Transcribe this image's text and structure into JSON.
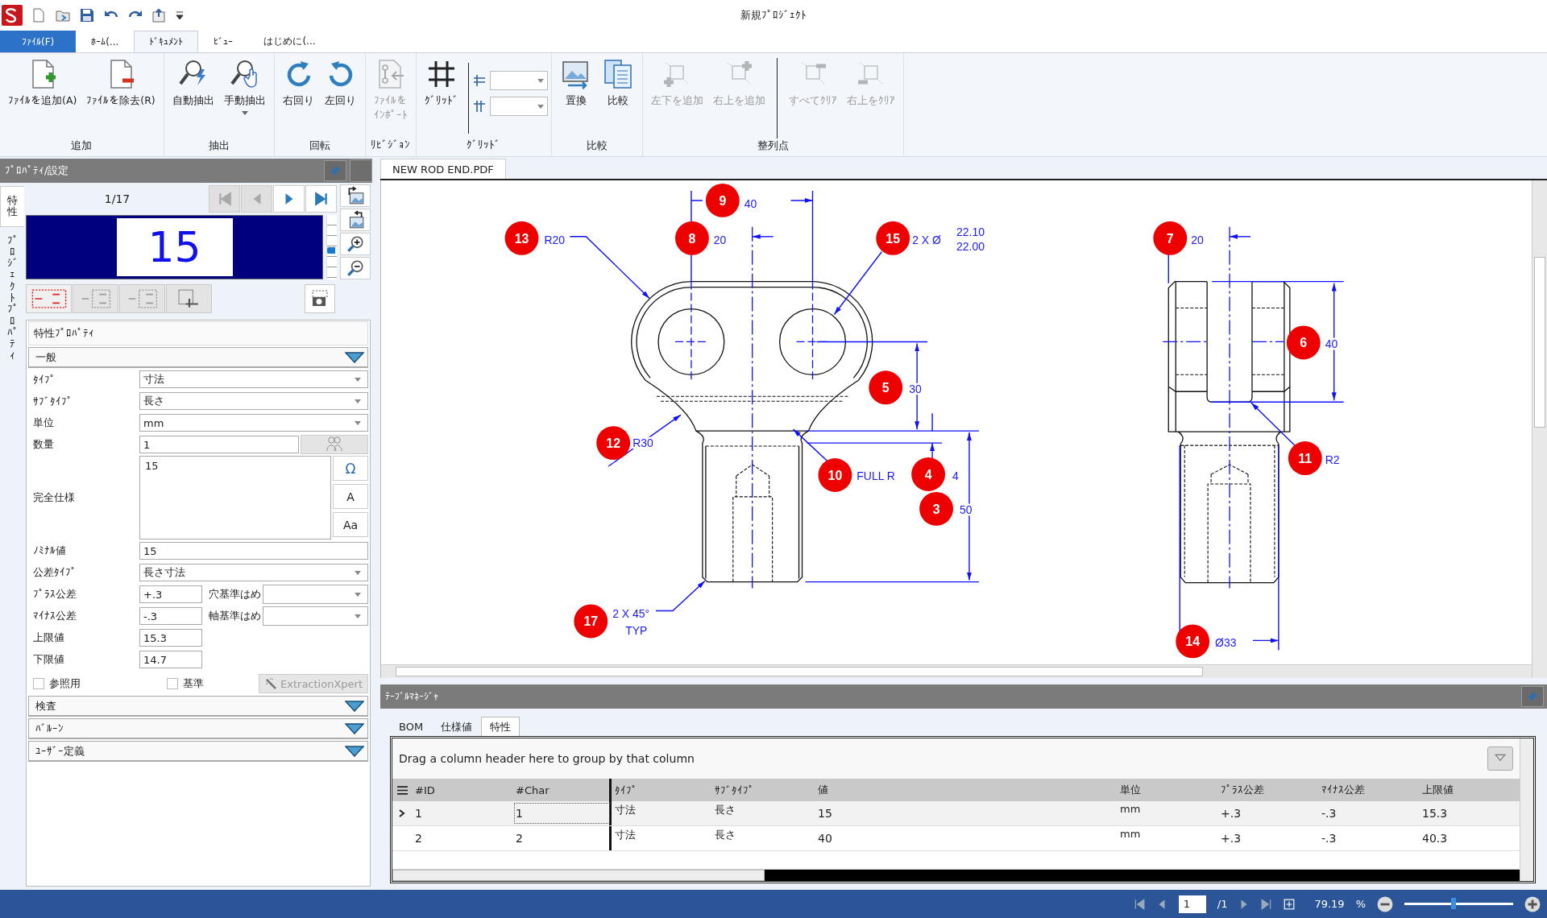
{
  "window": {
    "title": "新規ﾌﾟﾛｼﾞｪｸﾄ"
  },
  "ribbon_tabs": [
    {
      "label": "ﾌｧｲﾙ(F)",
      "kind": "file",
      "selected": false
    },
    {
      "label": "ﾎｰﾑ(...",
      "kind": "tab",
      "selected": false
    },
    {
      "label": "ﾄﾞｷｭﾒﾝﾄ",
      "kind": "tab",
      "selected": true
    },
    {
      "label": "ﾋﾞｭｰ",
      "kind": "tab",
      "selected": false
    },
    {
      "label": "はじめに(...",
      "kind": "tab",
      "selected": false
    }
  ],
  "ribbon": {
    "groups": [
      {
        "label": "追加",
        "kind": "buttons",
        "buttons": [
          {
            "label": "ﾌｧｲﾙを追加(A)",
            "disabled": false
          },
          {
            "label": "ﾌｧｲﾙを除去(R)",
            "disabled": false
          }
        ]
      },
      {
        "label": "抽出",
        "kind": "buttons",
        "buttons": [
          {
            "label": "自動抽出",
            "disabled": false
          },
          {
            "label": "手動抽出",
            "disabled": false,
            "dropdown": true
          }
        ]
      },
      {
        "label": "回転",
        "kind": "buttons",
        "buttons": [
          {
            "label": "右回り",
            "disabled": false
          },
          {
            "label": "左回り",
            "disabled": false
          }
        ]
      },
      {
        "label": "ﾘﾋﾞｼﾞｮﾝ",
        "kind": "buttons",
        "buttons": [
          {
            "label": "ﾌｧｲﾙを",
            "label_line2": "ｲﾝﾎﾟｰﾄ",
            "disabled": true
          }
        ]
      },
      {
        "label": "ｸﾞﾘｯﾄﾞ",
        "kind": "grid",
        "buttons": [
          {
            "label": "ｸﾞﾘｯﾄﾞ",
            "disabled": false
          }
        ]
      },
      {
        "label": "比較",
        "kind": "buttons",
        "buttons": [
          {
            "label": "置換",
            "disabled": false
          },
          {
            "label": "比較",
            "disabled": false
          }
        ]
      },
      {
        "label": "整列点",
        "kind": "buttons",
        "buttons": [
          {
            "label": "左下を追加",
            "disabled": true
          },
          {
            "label": "右上を追加",
            "disabled": true
          },
          {
            "label": "すべてｸﾘｱ",
            "disabled": true,
            "divider_before": true
          },
          {
            "label": "右上をｸﾘｱ",
            "disabled": true
          }
        ]
      }
    ]
  },
  "properties_panel": {
    "title": "ﾌﾟﾛﾊﾟﾃｨ/設定",
    "side_tabs": [
      {
        "label": "特性",
        "selected": true
      },
      {
        "label": "ﾌﾟﾛｼﾞｪｸﾄﾌﾟﾛﾊﾟﾃｨ",
        "selected": false
      }
    ],
    "counter": "1/17",
    "nav_buttons": [
      {
        "disabled": true
      },
      {
        "disabled": true
      },
      {
        "disabled": false
      },
      {
        "disabled": false
      }
    ],
    "preview": "15",
    "preview_zoom": {
      "level": 0.45
    },
    "format_buttons": [
      {
        "selected": true
      },
      {
        "selected": false
      },
      {
        "selected": false
      },
      {
        "selected": false
      }
    ],
    "section_title": "特性ﾌﾟﾛﾊﾟﾃｨ",
    "general": {
      "label": "一般",
      "fields": [
        {
          "kind": "dropdown",
          "label": "ﾀｲﾌﾟ",
          "value": "寸法"
        },
        {
          "kind": "dropdown",
          "label": "ｻﾌﾞﾀｲﾌﾟ",
          "value": "長さ"
        },
        {
          "kind": "dropdown",
          "label": "単位",
          "value": "mm"
        },
        {
          "kind": "count",
          "label": "数量",
          "value": "1"
        },
        {
          "kind": "spec",
          "label": "完全仕様",
          "value": "15",
          "tools": [
            "Ω",
            "A",
            "Aa"
          ]
        },
        {
          "kind": "text",
          "label": "ﾉﾐﾅﾙ値",
          "value": "15"
        },
        {
          "kind": "dropdown",
          "label": "公差ﾀｲﾌﾟ",
          "value": "長さ寸法"
        },
        {
          "kind": "tolerance",
          "label": "ﾌﾟﾗｽ公差",
          "value": "+.3",
          "fit_label": "穴基準はめ"
        },
        {
          "kind": "tolerance",
          "label": "ﾏｲﾅｽ公差",
          "value": "-.3",
          "fit_label": "軸基準はめ"
        },
        {
          "kind": "short",
          "label": "上限値",
          "value": "15.3"
        },
        {
          "kind": "short",
          "label": "下限値",
          "value": "14.7"
        }
      ],
      "checkboxes": [
        {
          "label": "参照用",
          "checked": false
        },
        {
          "label": "基準",
          "checked": false
        }
      ],
      "xpert_button": {
        "label": "ExtractionXpert",
        "disabled": true
      }
    },
    "sections": [
      {
        "label": "検査"
      },
      {
        "label": "ﾊﾞﾙｰﾝ"
      },
      {
        "label": "ﾕｰｻﾞｰ定義"
      }
    ]
  },
  "document": {
    "tabs": [
      {
        "label": "NEW ROD END.PDF",
        "selected": true
      }
    ],
    "callouts": [
      {
        "number": "9",
        "lines": [
          "40"
        ]
      },
      {
        "number": "13",
        "lines": [
          "R20"
        ]
      },
      {
        "number": "8",
        "lines": [
          "20"
        ]
      },
      {
        "number": "15",
        "lines": [
          "2 X Ø",
          "22.10",
          "22.00"
        ]
      },
      {
        "number": "7",
        "lines": [
          "20"
        ]
      },
      {
        "number": "6",
        "lines": [
          "40"
        ]
      },
      {
        "number": "5",
        "lines": [
          "30"
        ]
      },
      {
        "number": "12",
        "lines": [
          "R30"
        ]
      },
      {
        "number": "11",
        "lines": [
          "R2"
        ]
      },
      {
        "number": "10",
        "lines": [
          "FULL R"
        ]
      },
      {
        "number": "4",
        "lines": [
          "4"
        ]
      },
      {
        "number": "3",
        "lines": [
          "50"
        ]
      },
      {
        "number": "17",
        "lines": [
          "2 X 45°",
          "TYP"
        ]
      },
      {
        "number": "14",
        "lines": [
          "Ø33"
        ]
      }
    ]
  },
  "table_manager": {
    "title": "ﾃｰﾌﾞﾙﾏﾈｰｼﾞｬ",
    "tabs": [
      {
        "label": "BOM",
        "selected": false
      },
      {
        "label": "仕様値",
        "selected": false
      },
      {
        "label": "特性",
        "selected": true
      }
    ],
    "group_hint": "Drag a column header here to group by that column",
    "columns": [
      "#ID",
      "#Char",
      "ﾀｲﾌﾟ",
      "ｻﾌﾞﾀｲﾌﾟ",
      "値",
      "単位",
      "ﾌﾟﾗｽ公差",
      "ﾏｲﾅｽ公差",
      "上限値"
    ],
    "rows": [
      {
        "selected": true,
        "cells": [
          "1",
          "1",
          "寸法",
          "長さ",
          "15",
          "mm",
          "+.3",
          "-.3",
          "15.3"
        ]
      },
      {
        "selected": false,
        "cells": [
          "2",
          "2",
          "寸法",
          "長さ",
          "40",
          "mm",
          "+.3",
          "-.3",
          "40.3"
        ]
      }
    ]
  },
  "status_bar": {
    "page": "1",
    "page_total": "/1",
    "zoom": "79.19",
    "zoom_unit": "%",
    "zoom_slider": {
      "level": 0.45
    }
  }
}
